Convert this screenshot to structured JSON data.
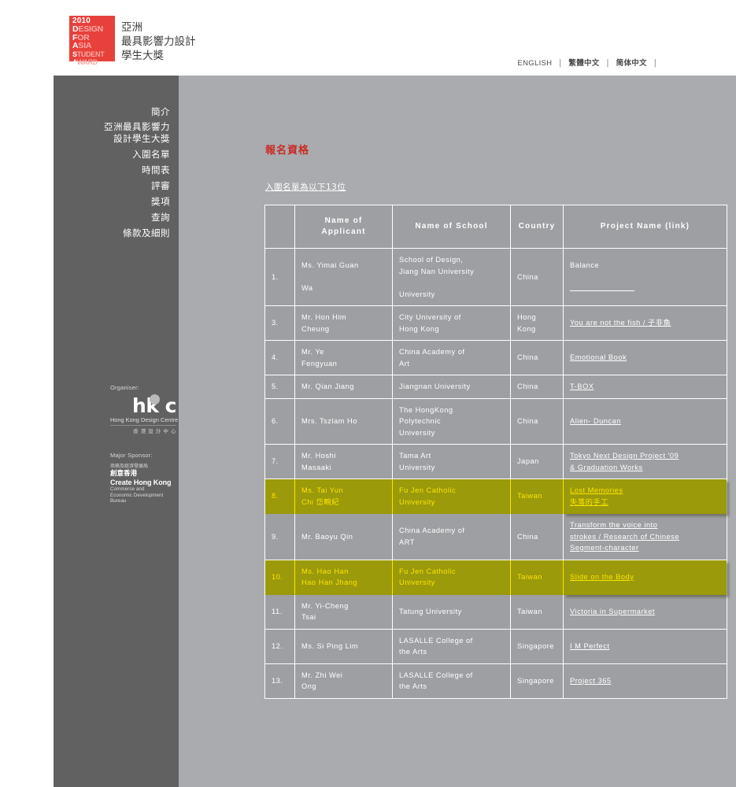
{
  "header": {
    "logo": {
      "year": "2010",
      "lines": [
        {
          "accent": "D",
          "rest": "ESIGN"
        },
        {
          "accent": "F",
          "rest": "OR"
        },
        {
          "accent": "A",
          "rest": "SIA"
        },
        {
          "accent": "S",
          "rest": "TUDENT"
        },
        {
          "accent": "A",
          "rest": "WARD"
        }
      ],
      "chinese": "亞洲\n最具影響力設計\n學生大獎"
    },
    "languages": [
      {
        "label": "ENGLISH",
        "type": "en"
      },
      {
        "label": "繁體中文",
        "type": "cn"
      },
      {
        "label": "简体中文",
        "type": "cn"
      }
    ],
    "separator": "|"
  },
  "sidebar": {
    "items": [
      {
        "label": "簡介",
        "two_line": false
      },
      {
        "label": "亞洲最具影響力\n設計學生大獎",
        "two_line": true
      },
      {
        "label": "入圍名單",
        "two_line": false
      },
      {
        "label": "時間表",
        "two_line": false
      },
      {
        "label": "評審",
        "two_line": false
      },
      {
        "label": "獎項",
        "two_line": false
      },
      {
        "label": "查詢",
        "two_line": false
      },
      {
        "label": "條款及細則",
        "two_line": false
      }
    ],
    "organiser": {
      "caption": "Organiser:",
      "logo_text": "hk c",
      "logo_sub": "Hong Kong Design Centre",
      "logo_cn": "香 港 設 計 中 心"
    },
    "sponsor": {
      "caption": "Major Sponsor:",
      "cn_small": "商務及經濟發展局",
      "cn_big": "創意香港",
      "en_name": "Create Hong Kong",
      "en_sub": "Commerce and\nEconomic Development Bureau"
    }
  },
  "content": {
    "page_title": "報名資格",
    "subtitle": "入圍名單為以下13位"
  },
  "table": {
    "headers": [
      "",
      "Name of\nApplicant",
      "Name of School",
      "Country",
      "Project Name (link)"
    ],
    "rows": [
      {
        "num": "1.",
        "applicant": "Ms. Yimai Guan\n\nWa",
        "school": "School of Design,\nJiang Nan University\n\nUniversity",
        "country": "China",
        "project": "Balance",
        "project_link": false,
        "project_extra_rule": true,
        "highlighted": false
      },
      {
        "num": "3.",
        "applicant": "Mr. Hon Him\nCheung",
        "school": "City University of\nHong Kong",
        "country": "Hong\nKong",
        "project": "You are not the fish / 子非魚",
        "project_link": true,
        "highlighted": false
      },
      {
        "num": "4.",
        "applicant": "Mr. Ye\nFengyuan",
        "school": "China Academy of\nArt",
        "country": "China",
        "project": "Emotional Book",
        "project_link": true,
        "highlighted": false
      },
      {
        "num": "5.",
        "applicant": "Mr. Qian Jiang",
        "school": "Jiangnan University",
        "country": "China",
        "project": "T-BOX",
        "project_link": true,
        "highlighted": false
      },
      {
        "num": "6.",
        "applicant": "Mrs. Tszlam Ho",
        "school": "The HongKong\nPolytechnic\nUniversity",
        "country": "China",
        "project": "Alien- Duncan",
        "project_link": true,
        "highlighted": false
      },
      {
        "num": "7.",
        "applicant": "Mr. Hoshi\nMasaaki",
        "school": "Tama Art\nUniversity",
        "country": "Japan",
        "project": "Tokyo Next Design Project '09\n& Graduation Works",
        "project_link": true,
        "highlighted": false
      },
      {
        "num": "8.",
        "applicant": "Ms. Tai Yun\nChi 岱畹紀",
        "school": "Fu Jen Catholic\nUniversity",
        "country": "Taiwan",
        "project": "Lost Memories\n失落的手工",
        "project_link": true,
        "highlighted": true
      },
      {
        "num": "9.",
        "applicant": "Mr. Baoyu Qin",
        "school": "China Academy of\nART",
        "country": "China",
        "project": "Transform the voice into\nstrokes / Research of Chinese\nSegment-character",
        "project_link": true,
        "highlighted": false
      },
      {
        "num": "10.",
        "applicant": "Ms. Hao Han\nHao Han Jhang",
        "school": "Fu Jen Catholic\nUniversity",
        "country": "Taiwan",
        "project": "Slide on the Body",
        "project_link": true,
        "highlighted": true
      },
      {
        "num": "11.",
        "applicant": "Mr. Yi-Cheng\nTsai",
        "school": "Tatung University",
        "country": "Taiwan",
        "project": "Victoria in Supermarket",
        "project_link": true,
        "highlighted": false
      },
      {
        "num": "12.",
        "applicant": "Ms. Si Ping Lim",
        "school": "LASALLE College of\nthe Arts",
        "country": "Singapore",
        "project": "I M Perfect",
        "project_link": true,
        "highlighted": false
      },
      {
        "num": "13.",
        "applicant": "Mr. Zhi Wei\nOng",
        "school": "LASALLE College of\nthe Arts",
        "country": "Singapore",
        "project": "Project 365",
        "project_link": true,
        "highlighted": false
      }
    ]
  },
  "colors": {
    "brand_red": "#e8413c",
    "title_red": "#cb2a23",
    "sidebar_bg": "#616161",
    "content_bg": "#a9abae",
    "table_bg": "#9d9fa2",
    "highlight_bg": "#9a9a0a",
    "highlight_text": "#ffe400"
  }
}
